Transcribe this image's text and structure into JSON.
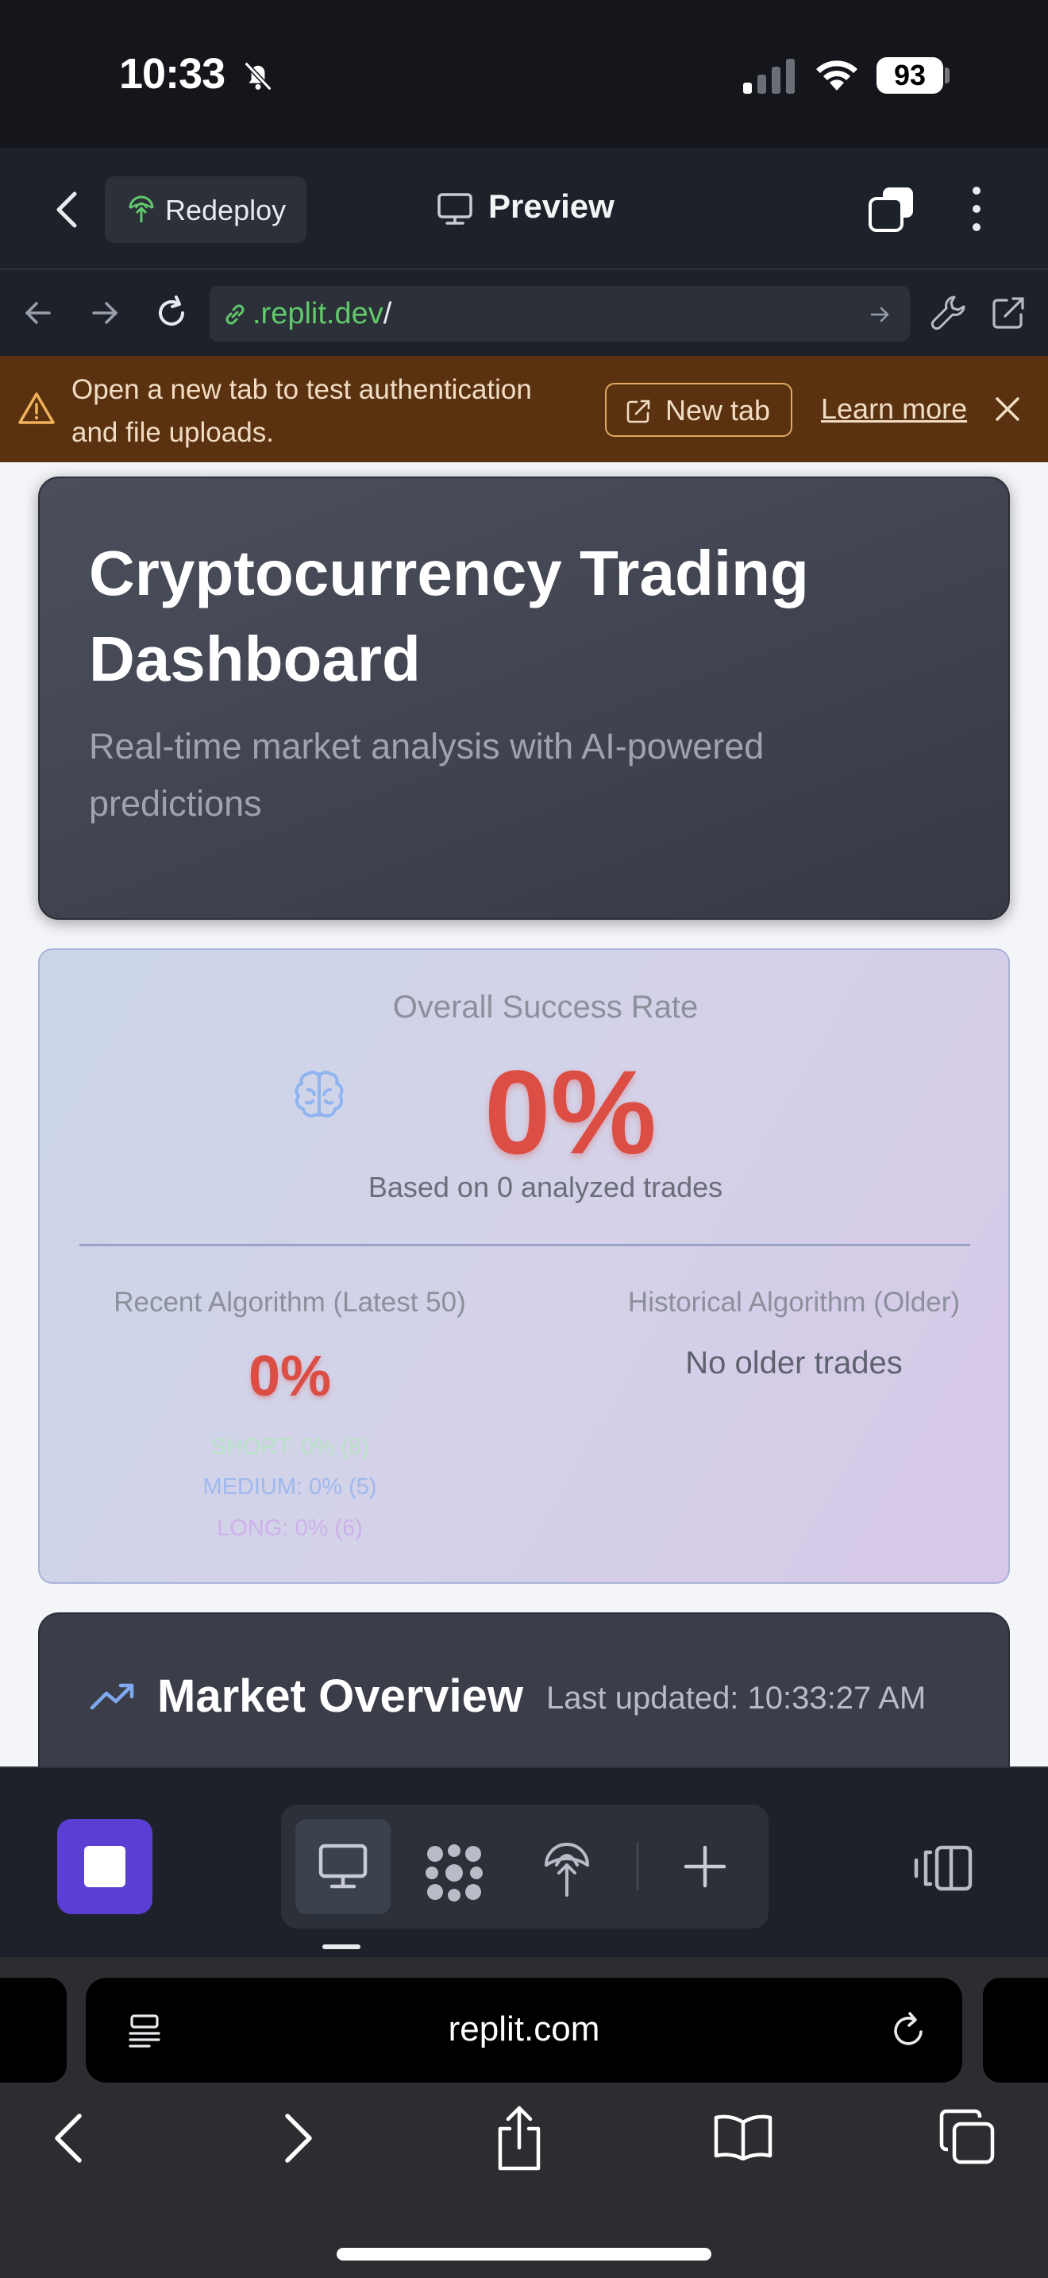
{
  "status_bar": {
    "time": "10:33",
    "battery": "93"
  },
  "header": {
    "redeploy_label": "Redeploy",
    "preview_label": "Preview"
  },
  "url_bar": {
    "domain": ".replit.dev",
    "path": "/"
  },
  "banner": {
    "message": "Open a new tab to test authentication and file uploads.",
    "new_tab_label": "New tab",
    "learn_more_label": "Learn more"
  },
  "hero": {
    "title": "Cryptocurrency Trading Dashboard",
    "subtitle": "Real-time market analysis with AI-powered predictions"
  },
  "stats": {
    "overall_label": "Overall Success Rate",
    "overall_value": "0%",
    "overall_basis": "Based on 0 analyzed trades",
    "recent_label": "Recent Algorithm (Latest 50)",
    "recent_value": "0%",
    "short_line": "SHORT: 0% (8)",
    "medium_line": "MEDIUM: 0% (5)",
    "long_line": "LONG: 0% (6)",
    "historical_label": "Historical Algorithm (Older)",
    "historical_value": "No older trades"
  },
  "market": {
    "title": "Market Overview",
    "updated": "Last updated: 10:33:27 AM"
  },
  "safari": {
    "url": "replit.com"
  },
  "colors": {
    "accent_purple": "#5b3fd4",
    "url_green": "#62c96b",
    "rate_red": "#dc4d44",
    "banner_bg": "#5a3210"
  }
}
